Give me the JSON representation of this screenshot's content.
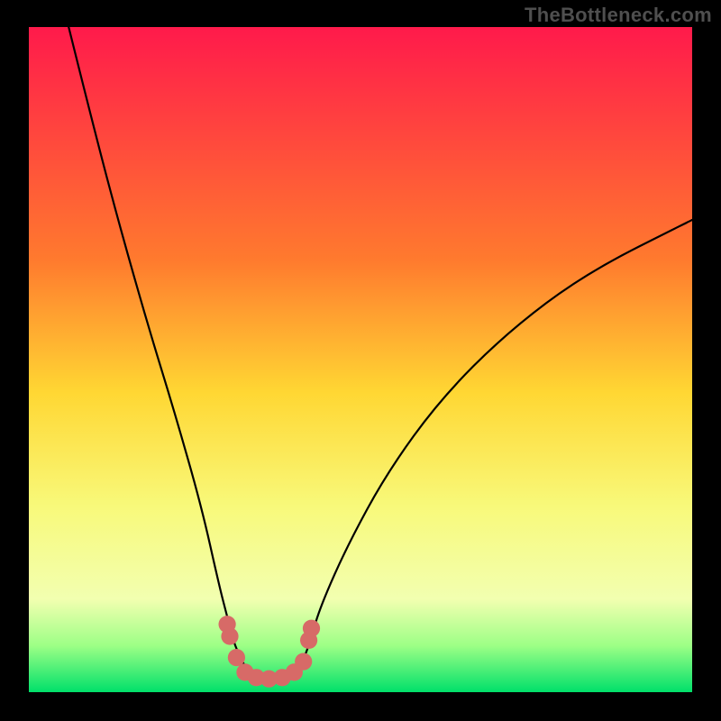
{
  "watermark": "TheBottleneck.com",
  "chart_data": {
    "type": "line",
    "title": "",
    "xlabel": "",
    "ylabel": "",
    "xlim": [
      0,
      100
    ],
    "ylim": [
      0,
      100
    ],
    "background_gradient": {
      "stops": [
        {
          "offset": 0,
          "color": "#ff1a4b"
        },
        {
          "offset": 35,
          "color": "#ff7a2e"
        },
        {
          "offset": 55,
          "color": "#ffd733"
        },
        {
          "offset": 72,
          "color": "#f8f97a"
        },
        {
          "offset": 86,
          "color": "#f2ffb0"
        },
        {
          "offset": 93,
          "color": "#9dff86"
        },
        {
          "offset": 100,
          "color": "#00e06a"
        }
      ]
    },
    "series": [
      {
        "name": "bottleneck-curve",
        "color": "#000000",
        "points": [
          {
            "x": 6.0,
            "y": 100.0
          },
          {
            "x": 10.0,
            "y": 84.0
          },
          {
            "x": 14.0,
            "y": 69.0
          },
          {
            "x": 18.0,
            "y": 55.0
          },
          {
            "x": 22.0,
            "y": 42.0
          },
          {
            "x": 26.0,
            "y": 28.0
          },
          {
            "x": 28.7,
            "y": 16.0
          },
          {
            "x": 30.0,
            "y": 11.0
          },
          {
            "x": 31.0,
            "y": 7.0
          },
          {
            "x": 33.0,
            "y": 3.0
          },
          {
            "x": 35.0,
            "y": 2.0
          },
          {
            "x": 38.0,
            "y": 2.0
          },
          {
            "x": 40.0,
            "y": 3.0
          },
          {
            "x": 41.5,
            "y": 5.0
          },
          {
            "x": 42.5,
            "y": 8.0
          },
          {
            "x": 44.0,
            "y": 13.0
          },
          {
            "x": 48.0,
            "y": 22.0
          },
          {
            "x": 54.0,
            "y": 33.0
          },
          {
            "x": 62.0,
            "y": 44.0
          },
          {
            "x": 72.0,
            "y": 54.0
          },
          {
            "x": 84.0,
            "y": 63.0
          },
          {
            "x": 100.0,
            "y": 71.0
          }
        ]
      }
    ],
    "markers": {
      "name": "optimum-zone",
      "color": "#d76a67",
      "radius_pct": 1.3,
      "points": [
        {
          "x": 29.9,
          "y": 10.2
        },
        {
          "x": 30.3,
          "y": 8.4
        },
        {
          "x": 31.3,
          "y": 5.2
        },
        {
          "x": 32.6,
          "y": 3.0
        },
        {
          "x": 34.3,
          "y": 2.2
        },
        {
          "x": 36.2,
          "y": 2.0
        },
        {
          "x": 38.2,
          "y": 2.2
        },
        {
          "x": 40.0,
          "y": 3.0
        },
        {
          "x": 41.4,
          "y": 4.6
        },
        {
          "x": 42.2,
          "y": 7.8
        },
        {
          "x": 42.6,
          "y": 9.6
        }
      ]
    }
  }
}
